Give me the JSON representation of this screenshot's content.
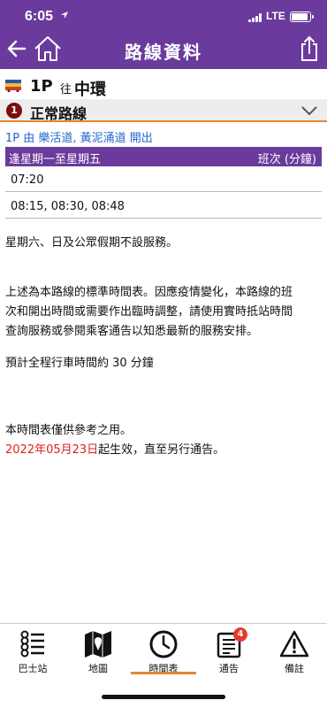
{
  "status": {
    "time": "6:05",
    "network": "LTE"
  },
  "nav": {
    "title": "路線資料"
  },
  "route": {
    "number": "1P",
    "to_label": "往",
    "destination": "中環"
  },
  "section": {
    "number": "1",
    "title": "正常路線"
  },
  "origin_text": "1P 由 樂活道, 黃泥涌道 開出",
  "timetable": {
    "day_header": "逢星期一至星期五",
    "freq_header": "班次 (分鐘)",
    "rows": [
      "07:20",
      "08:15, 08:30, 08:48"
    ]
  },
  "notes": {
    "holiday": "星期六、日及公眾假期不設服務。",
    "line1": "上述為本路線的標準時間表。因應疫情變化，本路線的班",
    "line2": "次和開出時間或需要作出臨時調整，請使用實時抵站時間",
    "line3": "查詢服務或參閱乘客通告以知悉最新的服務安排。",
    "journey": "預計全程行車時間約 30 分鐘",
    "reference": "本時間表僅供參考之用。",
    "effective_date": "2022年05月23日",
    "effective_rest": "起生效，直至另行通告。"
  },
  "tabs": [
    {
      "label": "巴士站",
      "icon": "bus-stop-icon"
    },
    {
      "label": "地圖",
      "icon": "map-icon"
    },
    {
      "label": "時間表",
      "icon": "clock-icon",
      "active": true
    },
    {
      "label": "通告",
      "icon": "notice-icon",
      "badge": "4"
    },
    {
      "label": "備註",
      "icon": "warning-icon"
    }
  ],
  "colors": {
    "header": "#6a3b9c",
    "accent": "#e0892c",
    "link": "#2266cc",
    "alert": "#e02020"
  }
}
